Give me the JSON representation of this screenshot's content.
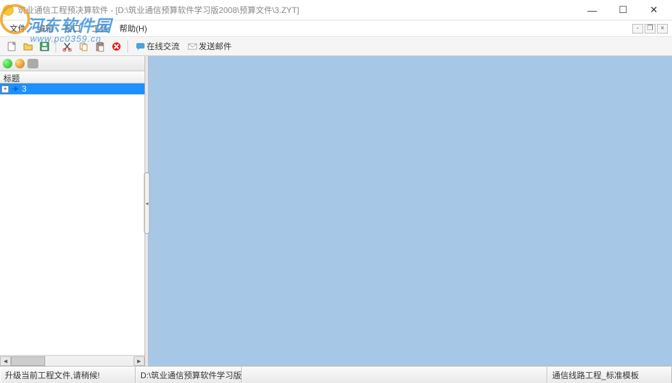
{
  "titlebar": {
    "title": "筑业通信工程预决算软件 - [D:\\筑业通信预算软件学习版2008\\预算文件\\3.ZYT]"
  },
  "menubar": {
    "file": "文件",
    "edit": "编辑",
    "window": "窗口",
    "tools": "工具",
    "help": "帮助(H)"
  },
  "toolbar": {
    "new_icon": "new-file-icon",
    "open_icon": "open-folder-icon",
    "save_icon": "save-disk-icon",
    "cut_icon": "cut-icon",
    "copy_icon": "copy-icon",
    "paste_icon": "paste-icon",
    "delete_icon": "delete-icon",
    "online_chat": "在线交流",
    "send_mail": "发送邮件"
  },
  "sidebar": {
    "column_header": "标题",
    "tree_items": [
      {
        "label": "3",
        "selected": true
      }
    ]
  },
  "statusbar": {
    "cell1": "升级当前工程文件,请稍候!",
    "cell2": "D:\\筑业通信预算软件学习版",
    "cell3": "",
    "cell4": "通信线路工程_标准模板"
  },
  "watermark": {
    "main_brand": "河东软件园",
    "sub_url": "www.pc0359.cn"
  }
}
